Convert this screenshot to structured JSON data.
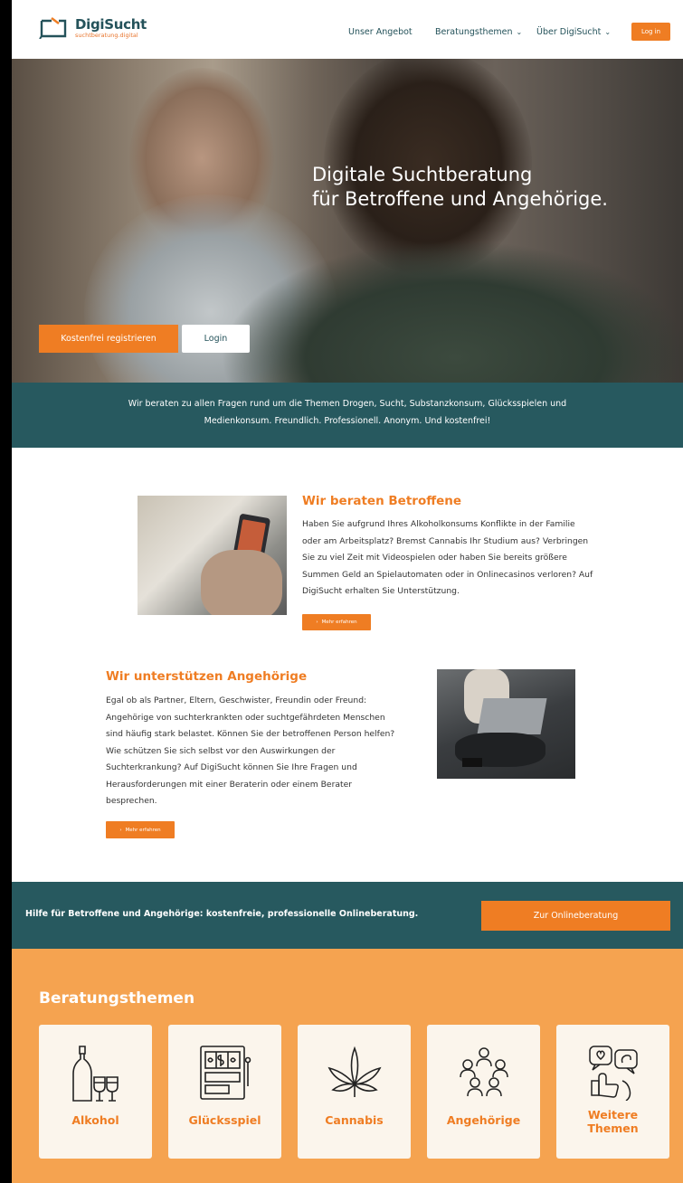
{
  "header": {
    "logo_name": "DigiSucht",
    "logo_sub": "suchtberatung.digital",
    "nav": [
      {
        "label": "Unser Angebot",
        "dropdown": false
      },
      {
        "label": "Beratungsthemen",
        "dropdown": true
      },
      {
        "label": "Über DigiSucht",
        "dropdown": true
      }
    ],
    "login_label": "Log in"
  },
  "hero": {
    "title_line1": "Digitale Suchtberatung",
    "title_line2": "für Betroffene und Angehörige.",
    "register_label": "Kostenfrei registrieren",
    "login_label": "Login"
  },
  "band": {
    "line1": "Wir beraten zu allen Fragen rund um die Themen Drogen, Sucht, Substanzkonsum, Glücksspielen und",
    "line2": "Medienkonsum. Freundlich. Professionell. Anonym. Und kostenfrei!"
  },
  "section1": {
    "title": "Wir beraten Betroffene",
    "lines": [
      "Haben Sie aufgrund Ihres Alkoholkonsums Konflikte in der Familie",
      "oder am Arbeitsplatz? Bremst Cannabis Ihr Studium aus? Verbringen",
      "Sie zu viel Zeit mit Videospielen oder haben Sie bereits größere",
      "Summen Geld an Spielautomaten oder in Onlinecasinos verloren? Auf",
      "DigiSucht erhalten Sie Unterstützung."
    ],
    "button_label": "Mehr erfahren"
  },
  "section2": {
    "title": "Wir unterstützen Angehörige",
    "lines": [
      "Egal ob als Partner, Eltern, Geschwister, Freundin oder Freund:",
      "Angehörige von suchterkrankten oder suchtgefährdeten Menschen",
      "sind häufig stark belastet. Können Sie der betroffenen Person helfen?",
      "Wie schützen Sie sich selbst vor den Auswirkungen der",
      "Suchterkrankung? Auf DigiSucht können Sie Ihre Fragen und",
      "Herausforderungen mit einer Beraterin oder einem Berater",
      "besprechen."
    ],
    "button_label": "Mehr erfahren"
  },
  "cta": {
    "text": "Hilfe für Betroffene und Angehörige: kostenfreie, professionelle Onlineberatung.",
    "button_label": "Zur Onlineberatung"
  },
  "topics": {
    "title": "Beratungsthemen",
    "cards": [
      {
        "label": "Alkohol",
        "icon": "bottle-glasses-icon"
      },
      {
        "label": "Glücksspiel",
        "icon": "slot-machine-icon"
      },
      {
        "label": "Cannabis",
        "icon": "cannabis-leaf-icon"
      },
      {
        "label": "Angehörige",
        "icon": "group-people-icon"
      },
      {
        "label_line1": "Weitere",
        "label_line2": "Themen",
        "icon": "chat-bubbles-icon"
      }
    ]
  },
  "colors": {
    "accent": "#ef7d23",
    "teal": "#27595f",
    "topics_bg": "#f5a350",
    "card_bg": "#fbf5ec"
  }
}
